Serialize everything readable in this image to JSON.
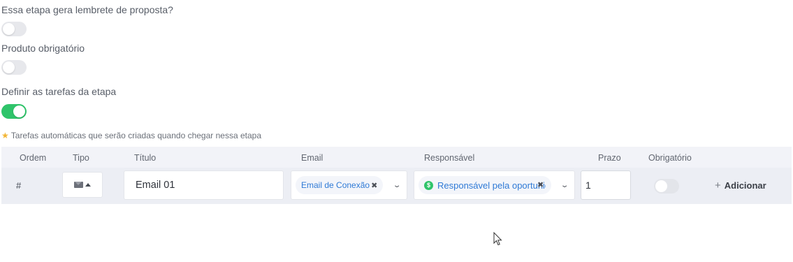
{
  "settings": {
    "proposal_reminder_label": "Essa etapa gera lembrete de proposta?",
    "proposal_reminder_on": false,
    "product_required_label": "Produto obrigatório",
    "product_required_on": false,
    "define_tasks_label": "Definir as tarefas da etapa",
    "define_tasks_on": true
  },
  "hint": "Tarefas automáticas que serão criadas quando chegar nessa etapa",
  "table": {
    "headers": {
      "ordem": "Ordem",
      "tipo": "Tipo",
      "titulo": "Título",
      "email": "Email",
      "responsavel": "Responsável",
      "prazo": "Prazo",
      "obrigatorio": "Obrigatório"
    },
    "row": {
      "ordem": "#",
      "tipo_icon": "envelope-icon",
      "titulo": "Email 01",
      "email": "Email de Conexão",
      "responsavel": "Responsável pela oportunidade",
      "prazo": "1",
      "obrigatorio": false
    },
    "add_label": "Adicionar"
  },
  "colors": {
    "toggle_on": "#2fc46a",
    "toggle_off": "#e7e8ec",
    "link_blue": "#2f7ad6",
    "star": "#f2b534",
    "header_bg": "#f2f3f8",
    "row_bg": "#eceef4"
  }
}
